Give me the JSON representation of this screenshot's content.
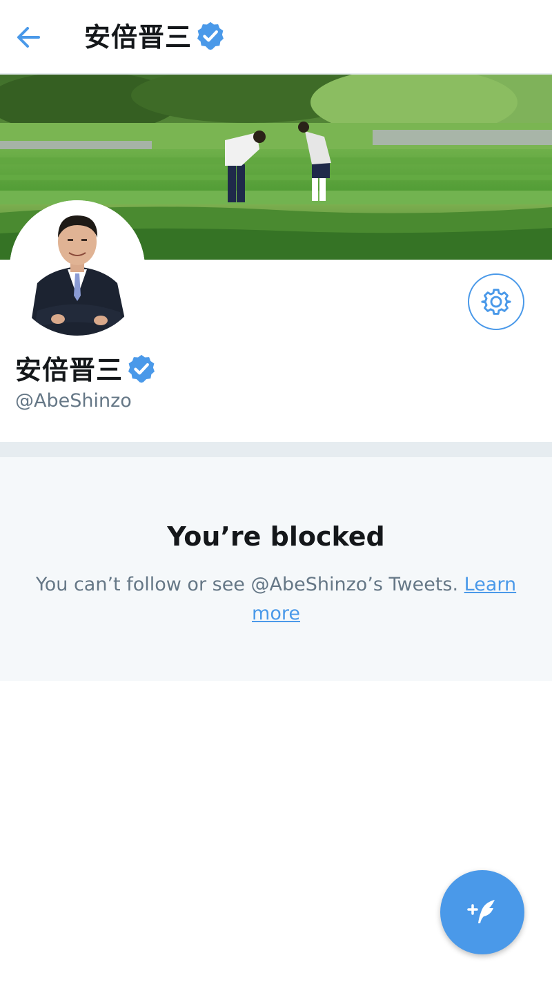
{
  "header": {
    "title": "安倍晋三",
    "back_icon": "arrow-left-icon",
    "verified_icon": "verified-badge-icon"
  },
  "profile": {
    "display_name": "安倍晋三",
    "handle": "@AbeShinzo",
    "verified": true,
    "settings_icon": "gear-icon"
  },
  "blocked": {
    "title": "You’re blocked",
    "message": "You can’t follow or see @AbeShinzo’s Tweets. ",
    "link_label": "Learn more"
  },
  "fab": {
    "icon": "compose-tweet-icon"
  },
  "colors": {
    "accent": "#4a99e9",
    "text_primary": "#14171a",
    "text_secondary": "#657786",
    "panel_bg": "#f5f8fa",
    "separator": "#e6ecf0"
  }
}
